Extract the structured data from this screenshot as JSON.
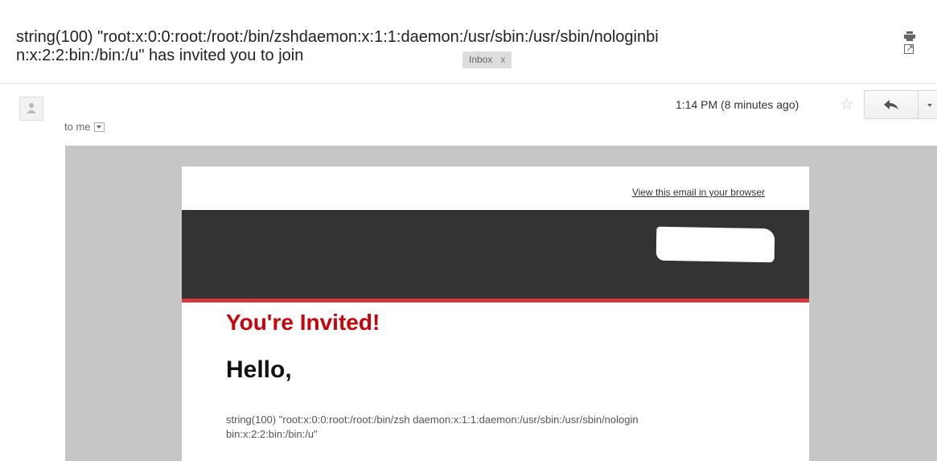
{
  "email": {
    "subject_line1": "string(100) \"root:x:0:0:root:/root:/bin/zshdaemon:x:1:1:daemon:/usr/sbin:/usr/sbin/nologinbi",
    "subject_line2": "n:x:2:2:bin:/bin:/u\" has invited you to join",
    "label": "Inbox",
    "label_remove": "x",
    "recipient": "to me",
    "time": "1:14 PM (8 minutes ago)",
    "icons": [
      "print-icon",
      "new-window-icon",
      "star-icon",
      "reply-icon",
      "more-icon",
      "avatar-icon"
    ]
  },
  "newsletter": {
    "view_in_browser": "View this email in your browser",
    "heading": "You're Invited!",
    "greeting": "Hello,",
    "body_line1": "string(100) \"root:x:0:0:root:/root:/bin/zsh daemon:x:1:1:daemon:/usr/sbin:/usr/sbin/nologin",
    "body_line2": "bin:x:2:2:bin:/bin:/u\"",
    "colors": {
      "heading": "#c4050b",
      "banner": "#333333",
      "accent_bar": "#d0383c",
      "outer_bg": "#c6c6c6"
    }
  }
}
